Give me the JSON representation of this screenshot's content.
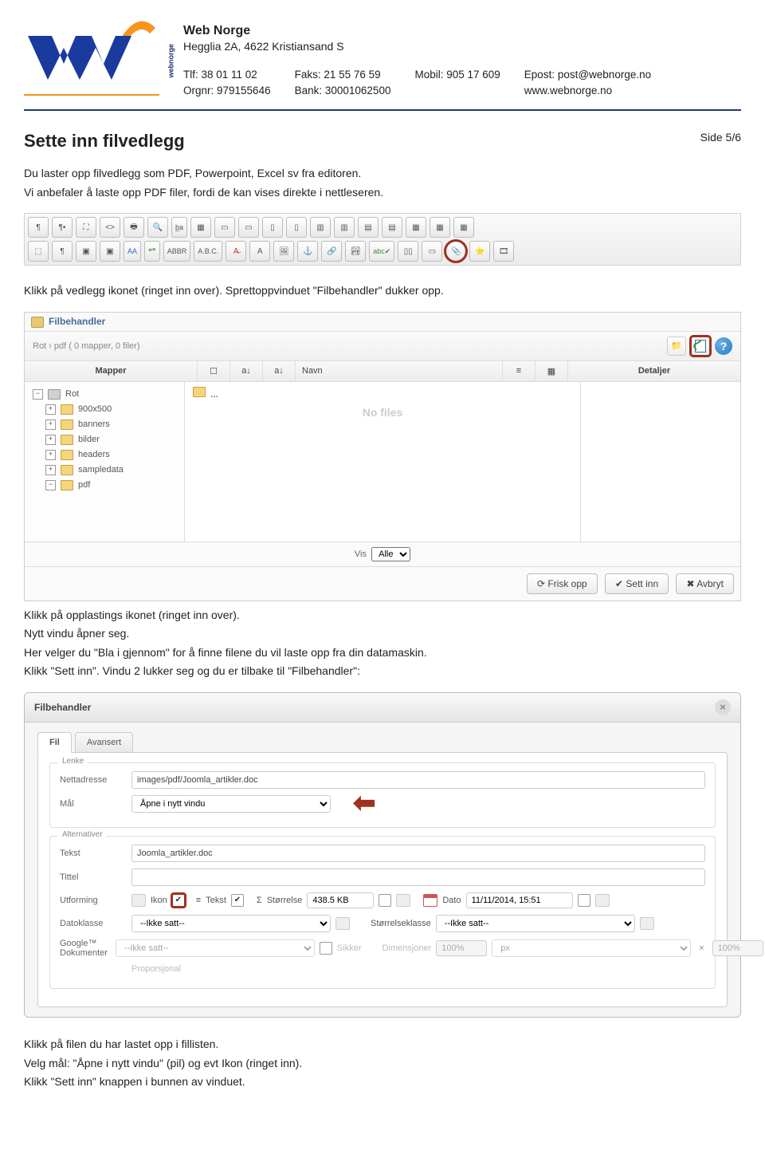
{
  "company": {
    "name": "Web Norge",
    "address": "Hegglia 2A, 4622 Kristiansand S",
    "tlf_label": "Tlf: 38 01 11 02",
    "orgnr_label": "Orgnr: 979155646",
    "faks_label": "Faks: 21 55 76 59",
    "bank_label": "Bank: 30001062500",
    "mobil_label": "Mobil: 905 17 609",
    "epost_label": "Epost: post@webnorge.no",
    "web_label": "www.webnorge.no",
    "logo_text": "webnorge"
  },
  "page_number": "Side 5/6",
  "heading": "Sette inn filvedlegg",
  "intro": {
    "p1": "Du laster opp filvedlegg som PDF, Powerpoint, Excel sv fra editoren.",
    "p2": "Vi anbefaler å laste opp PDF filer, fordi de kan vises direkte i nettleseren."
  },
  "para2": "Klikk på vedlegg ikonet (ringet inn over). Sprettoppvinduet \"Filbehandler\" dukker opp.",
  "para3": {
    "l1": "Klikk på opplastings ikonet (ringet inn over).",
    "l2": "Nytt vindu åpner seg.",
    "l3": "Her velger du \"Bla i gjennom\" for å finne filene du vil laste opp fra din datamaskin.",
    "l4": "Klikk \"Sett inn\". Vindu 2 lukker seg og du er tilbake til \"Filbehandler\":"
  },
  "para4": {
    "l1": "Klikk på filen du har lastet opp i fillisten.",
    "l2": "Velg mål: \"Åpne i nytt vindu\" (pil) og evt Ikon (ringet inn).",
    "l3": "Klikk \"Sett inn\" knappen i bunnen av vinduet."
  },
  "filbehandler": {
    "title": "Filbehandler",
    "breadcrumb": "Rot › pdf   ( 0 mapper, 0 filer)",
    "col_mapper": "Mapper",
    "col_navn": "Navn",
    "col_detaljer": "Detaljer",
    "no_files": "No files",
    "tree": [
      "Rot",
      "900x500",
      "banners",
      "bilder",
      "headers",
      "sampledata",
      "pdf"
    ],
    "dots": "...",
    "vis_label": "Vis",
    "vis_value": "Alle",
    "btn_frisk": "Frisk opp",
    "btn_sett": "Sett inn",
    "btn_avbryt": "Avbryt"
  },
  "dialog": {
    "title": "Filbehandler",
    "tabs": {
      "fil": "Fil",
      "avansert": "Avansert"
    },
    "fieldset_lenke": "Lenke",
    "fieldset_alt": "Alternativer",
    "labels": {
      "nettadresse": "Nettadresse",
      "maal": "Mål",
      "tekst": "Tekst",
      "tittel": "Tittel",
      "utforming": "Utforming",
      "datoklasse": "Datoklasse",
      "google": "Google™ Dokumenter",
      "ikon": "Ikon",
      "tekst2": "Tekst",
      "storrelse": "Størrelse",
      "dato": "Dato",
      "storrelseklasse": "Størrelseklasse",
      "sikker": "Sikker",
      "dimensjoner": "Dimensjoner",
      "proporsjonal": "Proporsjonal"
    },
    "values": {
      "nettadresse": "images/pdf/Joomla_artikler.doc",
      "maal": "Åpne i nytt vindu",
      "tekst": "Joomla_artikler.doc",
      "tittel": "",
      "storrelse": "438.5 KB",
      "dato": "11/11/2014, 15:51",
      "ikke_satt": "--Ikke satt--",
      "pct": "100%",
      "px": "px"
    }
  }
}
